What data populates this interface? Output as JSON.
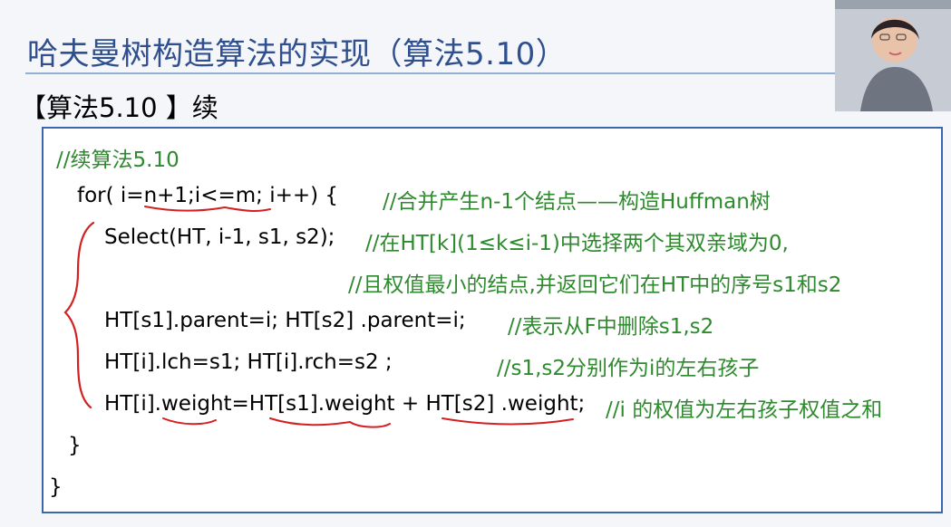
{
  "slide": {
    "title": "哈夫曼树构造算法的实现（算法5.10）",
    "subtitle": "【算法5.10 】续"
  },
  "code": {
    "lines": [
      {
        "code": "",
        "comment": "//续算法5.10"
      },
      {
        "code": "for( i=n+1;i<=m; i++) {",
        "comment": "//合并产生n-1个结点——构造Huffman树"
      },
      {
        "code": "Select(HT, i-1, s1, s2);",
        "comment": "//在HT[k](1≤k≤i-1)中选择两个其双亲域为0,"
      },
      {
        "code": "",
        "comment": "//且权值最小的结点,并返回它们在HT中的序号s1和s2"
      },
      {
        "code": "HT[s1].parent=i;   HT[s2] .parent=i;",
        "comment": "//表示从F中删除s1,s2"
      },
      {
        "code": "HT[i].lch=s1;    HT[i].rch=s2 ;",
        "comment": "//s1,s2分别作为i的左右孩子"
      },
      {
        "code": "HT[i].weight=HT[s1].weight + HT[s2] .weight;",
        "comment": "//i 的权值为左右孩子权值之和"
      },
      {
        "code": "}",
        "comment": ""
      },
      {
        "code": "}",
        "comment": ""
      }
    ]
  },
  "colors": {
    "title": "#2f4f8f",
    "comment": "#2d8a2d",
    "border": "#3d66b0",
    "annotation": "#d42020"
  },
  "icons": {
    "annotation_brace": "red-hand-drawn-brace",
    "webcam": "presenter-video-overlay"
  }
}
